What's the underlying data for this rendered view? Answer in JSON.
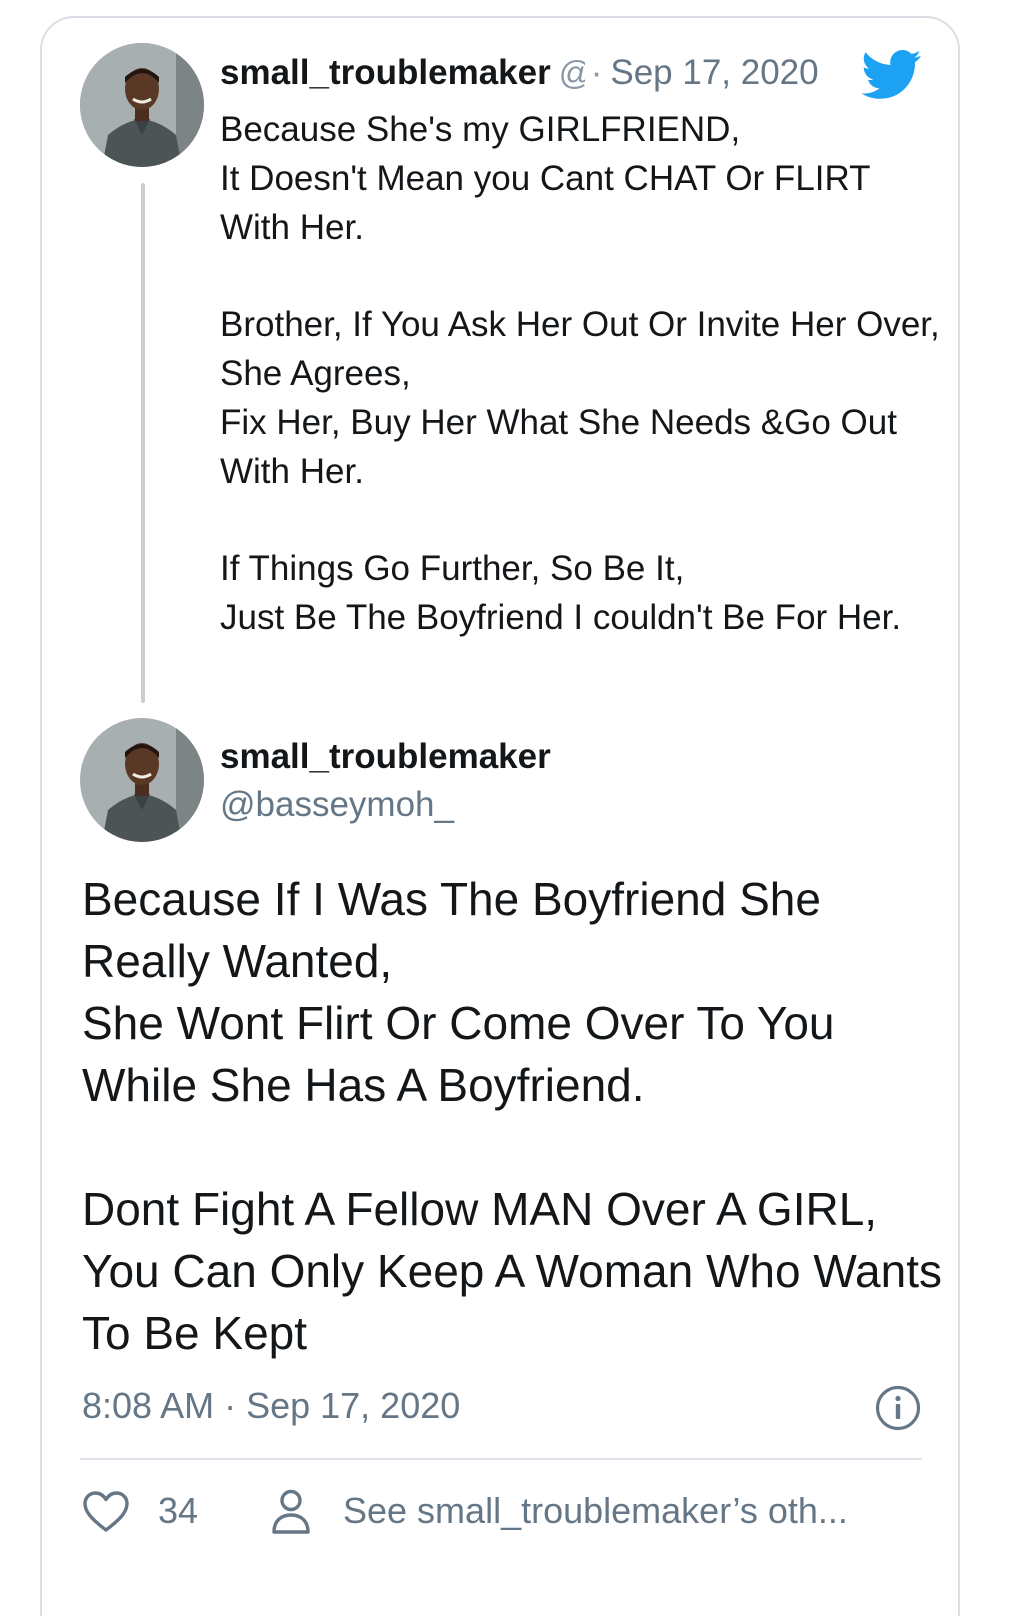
{
  "reply_tweet": {
    "author_name": "small_troublemaker",
    "handle_truncated": "@",
    "separator": "·",
    "date": "Sep 17, 2020",
    "paragraphs": [
      "Because She's my GIRLFRIEND,\nIt Doesn't Mean you Cant CHAT Or FLIRT With Her.",
      "Brother, If You Ask Her Out Or Invite Her Over, She Agrees,\nFix Her, Buy Her What She Needs &Go Out With Her.",
      "If Things Go Further, So Be It,\nJust Be The Boyfriend I couldn't Be For Her."
    ]
  },
  "main_tweet": {
    "author_name": "small_troublemaker",
    "handle": "@basseymoh_",
    "paragraphs": [
      "Because If I Was The Boyfriend She Really Wanted,\nShe Wont Flirt Or Come Over To You While She Has A Boyfriend.",
      "Dont Fight A Fellow MAN Over A GIRL,\nYou Can Only Keep A Woman Who Wants To Be Kept"
    ],
    "timestamp": "8:08 AM · Sep 17, 2020"
  },
  "footer": {
    "like_count": "34",
    "see_others_label": "See small_troublemaker’s oth..."
  },
  "icons": {
    "brand": "twitter-bird-icon",
    "info": "info-icon",
    "like": "heart-icon",
    "profile": "person-icon"
  },
  "colors": {
    "twitter_blue": "#1da1f2",
    "secondary_text": "#657786",
    "primary_text": "#14171a",
    "thread_line": "#c4cfd6"
  }
}
